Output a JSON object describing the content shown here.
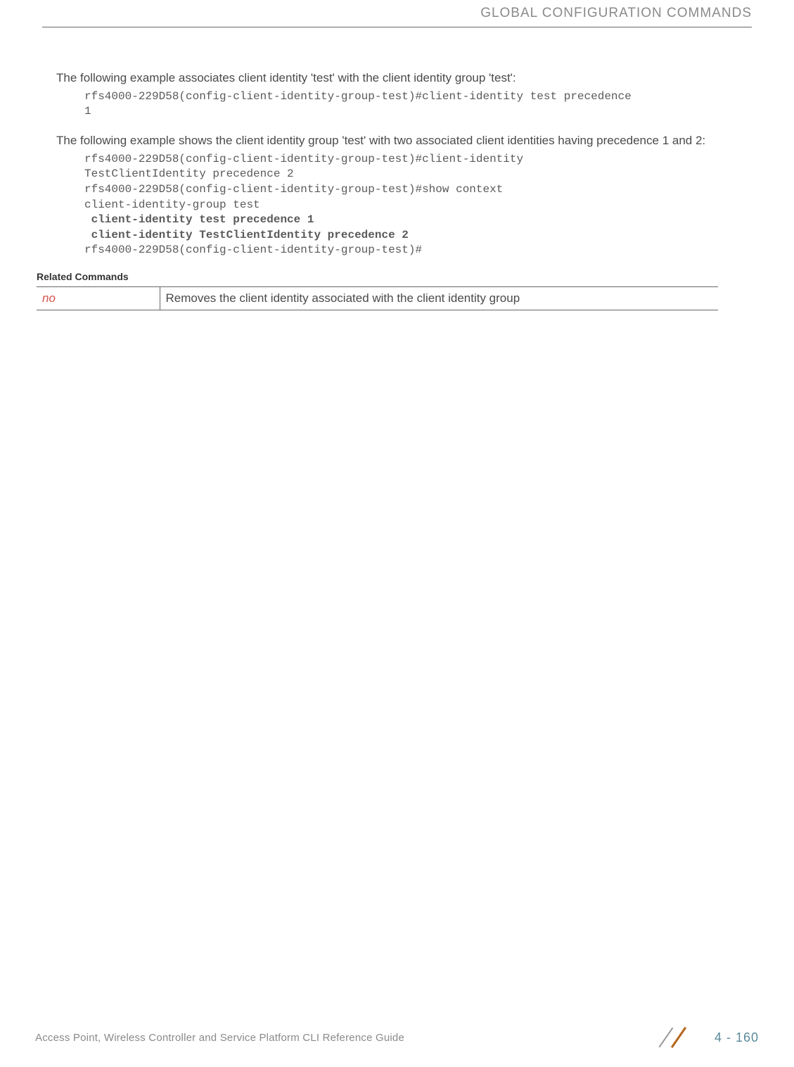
{
  "header": {
    "title": "GLOBAL CONFIGURATION COMMANDS"
  },
  "content": {
    "intro1": "The following example associates client identity 'test' with the client identity group 'test':",
    "code1_line1": "rfs4000-229D58(config-client-identity-group-test)#client-identity test precedence",
    "code1_line2": "1",
    "intro2": "The following example shows the client identity group 'test' with two associated client identities having precedence 1 and 2:",
    "code2_line1": "rfs4000-229D58(config-client-identity-group-test)#client-identity",
    "code2_line2": "TestClientIdentity precedence 2",
    "code2_line3": "rfs4000-229D58(config-client-identity-group-test)#show context",
    "code2_line4": "client-identity-group test",
    "code2_bold1": " client-identity test precedence 1",
    "code2_bold2": " client-identity TestClientIdentity precedence 2",
    "code2_line5": "rfs4000-229D58(config-client-identity-group-test)#"
  },
  "related": {
    "heading": "Related Commands",
    "row": {
      "cmd": "no",
      "desc": "Removes the client identity associated with the client identity group"
    }
  },
  "footer": {
    "left": "Access Point, Wireless Controller and Service Platform CLI Reference Guide",
    "pageNumber": "4 - 160"
  }
}
